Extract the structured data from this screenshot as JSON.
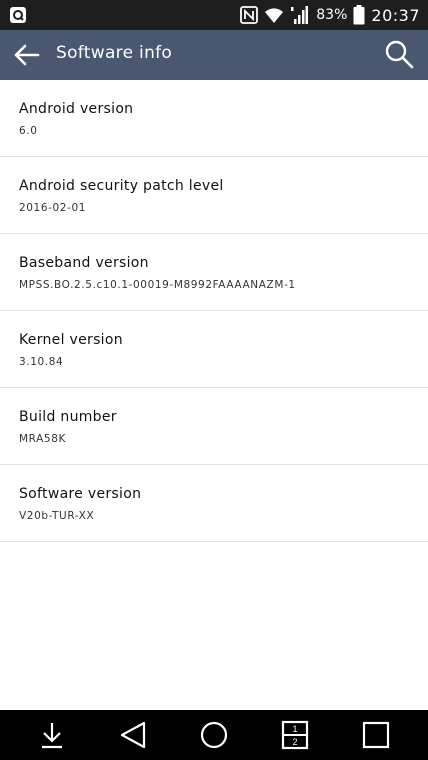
{
  "status_bar": {
    "left_icon": "screenshot-notification-icon",
    "icons": [
      "nfc-icon",
      "wifi-icon",
      "cell-signal-icon",
      "battery-icon"
    ],
    "battery_percent": "83%",
    "time": "20:37"
  },
  "app_bar": {
    "title": "Software info",
    "back_icon": "arrow-left-icon",
    "search_icon": "search-icon",
    "background_color": "#4a5770"
  },
  "items": [
    {
      "title": "Android version",
      "value": "6.0"
    },
    {
      "title": "Android security patch level",
      "value": "2016-02-01"
    },
    {
      "title": "Baseband version",
      "value": "MPSS.BO.2.5.c10.1-00019-M8992FAAAANAZM-1"
    },
    {
      "title": "Kernel version",
      "value": "3.10.84"
    },
    {
      "title": "Build number",
      "value": "MRA58K"
    },
    {
      "title": "Software version",
      "value": "V20b-TUR-XX"
    }
  ],
  "nav_bar": {
    "buttons": [
      "notification-pull-icon",
      "back-triangle-icon",
      "home-circle-icon",
      "dual-window-icon",
      "recents-square-icon"
    ],
    "dual_window_numbers": [
      "1",
      "2"
    ]
  }
}
